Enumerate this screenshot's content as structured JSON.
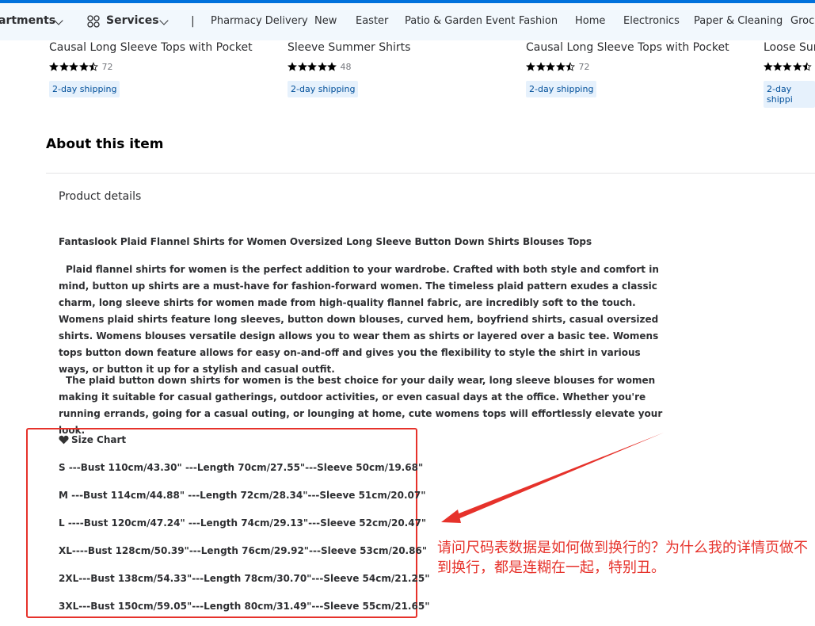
{
  "nav": {
    "departments": "artments",
    "services": "Services",
    "divider": "|",
    "links": [
      "Pharmacy Delivery",
      "New",
      "Easter",
      "Patio & Garden Event",
      "Fashion",
      "Home",
      "Electronics",
      "Paper & Cleaning",
      "Groce"
    ]
  },
  "cards": [
    {
      "title": "Causal Long Sleeve Tops with Pocket",
      "rating": 4.5,
      "count": "72",
      "badge": "2-day shipping"
    },
    {
      "title": "Sleeve Summer Shirts",
      "rating": 5,
      "count": "48",
      "badge": "2-day shipping"
    },
    {
      "title": "Causal Long Sleeve Tops with Pocket",
      "rating": 4.5,
      "count": "72",
      "badge": "2-day shipping"
    },
    {
      "title": "Loose Sur",
      "rating": 4.5,
      "count": "",
      "badge": "2-day shippi"
    }
  ],
  "about": {
    "heading": "About this item",
    "product_details": "Product details",
    "headline": "Fantaslook Plaid Flannel Shirts for Women Oversized Long Sleeve Button Down Shirts Blouses Tops",
    "para1": "Plaid flannel shirts for women is the perfect addition to your wardrobe. Crafted with both style and comfort in mind, button up shirts are a must-have for fashion-forward women. The timeless plaid pattern exudes a classic charm, long sleeve shirts for women made from high-quality flannel fabric, are incredibly soft to the touch. Womens plaid shirts feature long sleeves, button down blouses, curved hem, boyfriend shirts, casual oversized shirts. Womens blouses versatile design allows you to wear them as shirts or layered over a basic tee. Womens tops button down feature allows for easy on-and-off and gives you the flexibility to style the shirt in various ways, or button it up for a stylish and casual outfit.",
    "para2": "The plaid button down shirts for women is the best choice for your daily wear, long sleeve blouses for women making it suitable for casual gatherings, outdoor activities, or even casual days at the office. Whether you're running errands, going for a casual outing, or lounging at home, cute womens tops will effortlessly elevate your look."
  },
  "size_chart": {
    "title": "Size Chart",
    "rows": [
      "S ---Bust 110cm/43.30\" ---Length 70cm/27.55\"---Sleeve 50cm/19.68\"",
      "M ---Bust 114cm/44.88\" ---Length 72cm/28.34\"---Sleeve 51cm/20.07\"",
      "L ----Bust 120cm/47.24\" ---Length 74cm/29.13\"---Sleeve 52cm/20.47\"",
      "XL----Bust 128cm/50.39\"---Length 76cm/29.92\"---Sleeve 53cm/20.86\"",
      "2XL---Bust 138cm/54.33\"---Length 78cm/30.70\"---Sleeve 54cm/21.25\"",
      "3XL---Bust 150cm/59.05\"---Length 80cm/31.49\"---Sleeve 55cm/21.65\""
    ]
  },
  "annotation": {
    "question": "请问尺码表数据是如何做到换行的？为什么我的详情页做不到换行，都是连糊在一起，特别丑。",
    "color": "#e6322b"
  },
  "colors": {
    "brand": "#0071dc",
    "nav_bg": "#f2f8fd",
    "badge_bg": "#e6f1fc"
  }
}
